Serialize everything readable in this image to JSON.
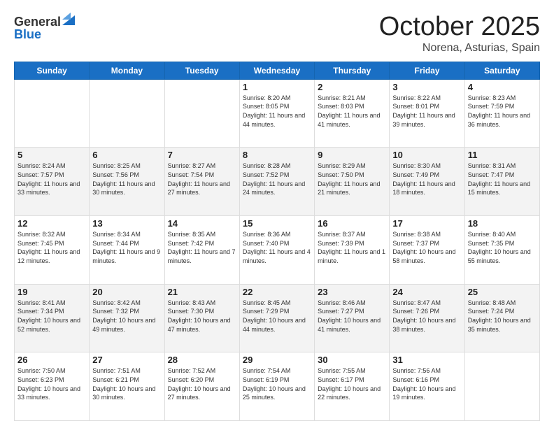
{
  "logo": {
    "general": "General",
    "blue": "Blue"
  },
  "title": "October 2025",
  "location": "Norena, Asturias, Spain",
  "days_header": [
    "Sunday",
    "Monday",
    "Tuesday",
    "Wednesday",
    "Thursday",
    "Friday",
    "Saturday"
  ],
  "weeks": [
    [
      {
        "day": "",
        "info": ""
      },
      {
        "day": "",
        "info": ""
      },
      {
        "day": "",
        "info": ""
      },
      {
        "day": "1",
        "info": "Sunrise: 8:20 AM\nSunset: 8:05 PM\nDaylight: 11 hours and 44 minutes."
      },
      {
        "day": "2",
        "info": "Sunrise: 8:21 AM\nSunset: 8:03 PM\nDaylight: 11 hours and 41 minutes."
      },
      {
        "day": "3",
        "info": "Sunrise: 8:22 AM\nSunset: 8:01 PM\nDaylight: 11 hours and 39 minutes."
      },
      {
        "day": "4",
        "info": "Sunrise: 8:23 AM\nSunset: 7:59 PM\nDaylight: 11 hours and 36 minutes."
      }
    ],
    [
      {
        "day": "5",
        "info": "Sunrise: 8:24 AM\nSunset: 7:57 PM\nDaylight: 11 hours and 33 minutes."
      },
      {
        "day": "6",
        "info": "Sunrise: 8:25 AM\nSunset: 7:56 PM\nDaylight: 11 hours and 30 minutes."
      },
      {
        "day": "7",
        "info": "Sunrise: 8:27 AM\nSunset: 7:54 PM\nDaylight: 11 hours and 27 minutes."
      },
      {
        "day": "8",
        "info": "Sunrise: 8:28 AM\nSunset: 7:52 PM\nDaylight: 11 hours and 24 minutes."
      },
      {
        "day": "9",
        "info": "Sunrise: 8:29 AM\nSunset: 7:50 PM\nDaylight: 11 hours and 21 minutes."
      },
      {
        "day": "10",
        "info": "Sunrise: 8:30 AM\nSunset: 7:49 PM\nDaylight: 11 hours and 18 minutes."
      },
      {
        "day": "11",
        "info": "Sunrise: 8:31 AM\nSunset: 7:47 PM\nDaylight: 11 hours and 15 minutes."
      }
    ],
    [
      {
        "day": "12",
        "info": "Sunrise: 8:32 AM\nSunset: 7:45 PM\nDaylight: 11 hours and 12 minutes."
      },
      {
        "day": "13",
        "info": "Sunrise: 8:34 AM\nSunset: 7:44 PM\nDaylight: 11 hours and 9 minutes."
      },
      {
        "day": "14",
        "info": "Sunrise: 8:35 AM\nSunset: 7:42 PM\nDaylight: 11 hours and 7 minutes."
      },
      {
        "day": "15",
        "info": "Sunrise: 8:36 AM\nSunset: 7:40 PM\nDaylight: 11 hours and 4 minutes."
      },
      {
        "day": "16",
        "info": "Sunrise: 8:37 AM\nSunset: 7:39 PM\nDaylight: 11 hours and 1 minute."
      },
      {
        "day": "17",
        "info": "Sunrise: 8:38 AM\nSunset: 7:37 PM\nDaylight: 10 hours and 58 minutes."
      },
      {
        "day": "18",
        "info": "Sunrise: 8:40 AM\nSunset: 7:35 PM\nDaylight: 10 hours and 55 minutes."
      }
    ],
    [
      {
        "day": "19",
        "info": "Sunrise: 8:41 AM\nSunset: 7:34 PM\nDaylight: 10 hours and 52 minutes."
      },
      {
        "day": "20",
        "info": "Sunrise: 8:42 AM\nSunset: 7:32 PM\nDaylight: 10 hours and 49 minutes."
      },
      {
        "day": "21",
        "info": "Sunrise: 8:43 AM\nSunset: 7:30 PM\nDaylight: 10 hours and 47 minutes."
      },
      {
        "day": "22",
        "info": "Sunrise: 8:45 AM\nSunset: 7:29 PM\nDaylight: 10 hours and 44 minutes."
      },
      {
        "day": "23",
        "info": "Sunrise: 8:46 AM\nSunset: 7:27 PM\nDaylight: 10 hours and 41 minutes."
      },
      {
        "day": "24",
        "info": "Sunrise: 8:47 AM\nSunset: 7:26 PM\nDaylight: 10 hours and 38 minutes."
      },
      {
        "day": "25",
        "info": "Sunrise: 8:48 AM\nSunset: 7:24 PM\nDaylight: 10 hours and 35 minutes."
      }
    ],
    [
      {
        "day": "26",
        "info": "Sunrise: 7:50 AM\nSunset: 6:23 PM\nDaylight: 10 hours and 33 minutes."
      },
      {
        "day": "27",
        "info": "Sunrise: 7:51 AM\nSunset: 6:21 PM\nDaylight: 10 hours and 30 minutes."
      },
      {
        "day": "28",
        "info": "Sunrise: 7:52 AM\nSunset: 6:20 PM\nDaylight: 10 hours and 27 minutes."
      },
      {
        "day": "29",
        "info": "Sunrise: 7:54 AM\nSunset: 6:19 PM\nDaylight: 10 hours and 25 minutes."
      },
      {
        "day": "30",
        "info": "Sunrise: 7:55 AM\nSunset: 6:17 PM\nDaylight: 10 hours and 22 minutes."
      },
      {
        "day": "31",
        "info": "Sunrise: 7:56 AM\nSunset: 6:16 PM\nDaylight: 10 hours and 19 minutes."
      },
      {
        "day": "",
        "info": ""
      }
    ]
  ]
}
